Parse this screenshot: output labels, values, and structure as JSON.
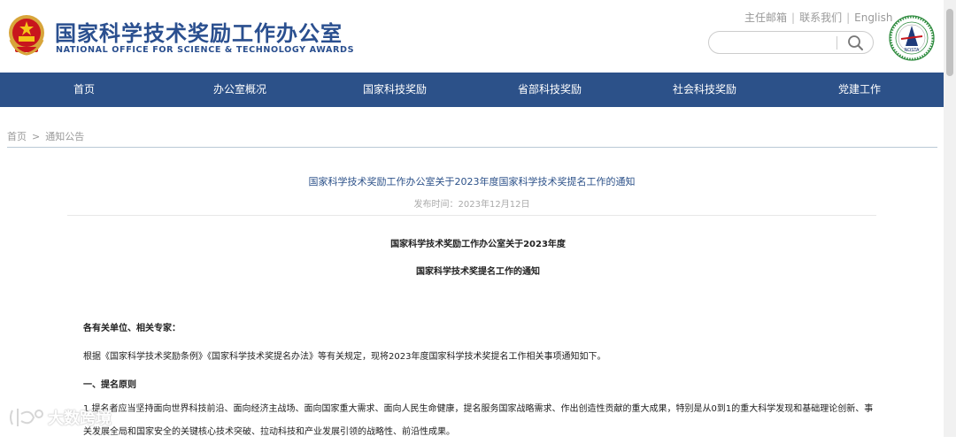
{
  "header": {
    "logo_cn": "国家科学技术奖励工作办公室",
    "logo_en": "NATIONAL OFFICE FOR SCIENCE & TECHNOLOGY AWARDS",
    "toplinks": [
      "主任邮箱",
      "联系我们",
      "English"
    ],
    "search": {
      "placeholder": "",
      "icon": "search-icon"
    },
    "nosta_label": "NOSTA"
  },
  "nav": {
    "items": [
      "首页",
      "办公室概况",
      "国家科技奖励",
      "省部科技奖励",
      "社会科技奖励",
      "党建工作"
    ]
  },
  "breadcrumb": {
    "home": "首页",
    "separator": ">",
    "current": "通知公告"
  },
  "article": {
    "title": "国家科学技术奖励工作办公室关于2023年度国家科学技术奖提名工作的通知",
    "date": "发布时间：2023年12月12日",
    "heading_line1": "国家科学技术奖励工作办公室关于2023年度",
    "heading_line2": "国家科学技术奖提名工作的通知",
    "salutation": "各有关单位、相关专家：",
    "intro": "根据《国家科学技术奖励条例》《国家科学技术奖提名办法》等有关规定，现将2023年度国家科学技术奖提名工作相关事项通知如下。",
    "section1": "一、提名原则",
    "para1": "1.提名者应当坚持面向世界科技前沿、面向经济主战场、面向国家重大需求、面向人民生命健康，提名服务国家战略需求、作出创造性贡献的重大成果，特别是从0到1的重大科学发现和基础理论创新、事关发展全局和国家安全的关键核心技术突破、拉动科技和产业发展引领的战略性、前沿性成果。"
  },
  "watermark": {
    "text": "大数跨境"
  },
  "colors": {
    "nav_bg": "#2c5189",
    "brand_blue": "#2a4f8f",
    "title_blue": "#2c5189"
  }
}
